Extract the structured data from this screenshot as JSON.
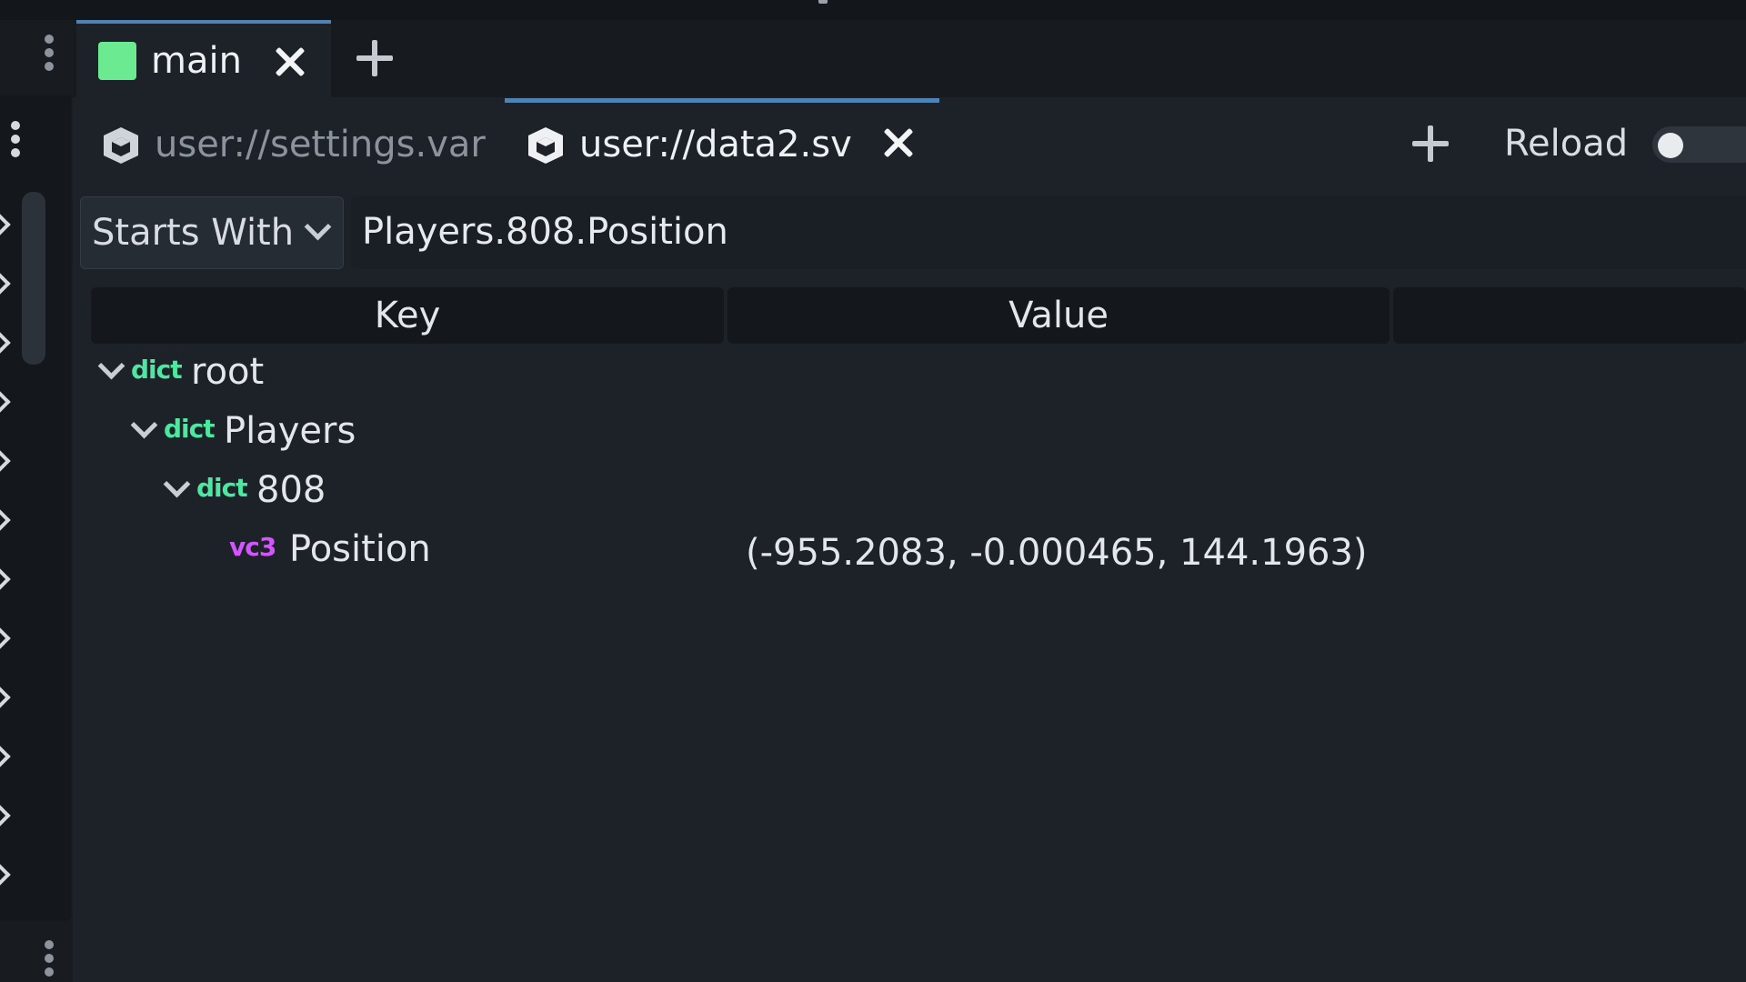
{
  "window": {
    "tabs": [
      {
        "label": "main",
        "color": "#6bea92"
      }
    ]
  },
  "file_tabs": [
    {
      "label": "user://settings.var",
      "active": false
    },
    {
      "label": "user://data2.sv",
      "active": true
    }
  ],
  "toolbar": {
    "reload_label": "Reload",
    "reload_enabled": false
  },
  "filter": {
    "mode": "Starts With",
    "query": "Players.808.Position"
  },
  "table": {
    "columns": [
      "Key",
      "Value"
    ],
    "rows": [
      {
        "type": "dict",
        "key": "root",
        "depth": 0,
        "expanded": true,
        "value": ""
      },
      {
        "type": "dict",
        "key": "Players",
        "depth": 1,
        "expanded": true,
        "value": ""
      },
      {
        "type": "dict",
        "key": "808",
        "depth": 2,
        "expanded": true,
        "value": ""
      },
      {
        "type": "vc3",
        "key": "Position",
        "depth": 3,
        "value": "(-955.2083, -0.000465, 144.1963)"
      }
    ]
  },
  "colors": {
    "accent": "#4f83b5",
    "dict_tag": "#4ce8a0",
    "vec_tag": "#d455ff",
    "background": "#1d2229"
  },
  "icons": [
    "menu-dots-icon",
    "close-icon",
    "add-icon",
    "package-icon",
    "chevron-down-icon"
  ]
}
